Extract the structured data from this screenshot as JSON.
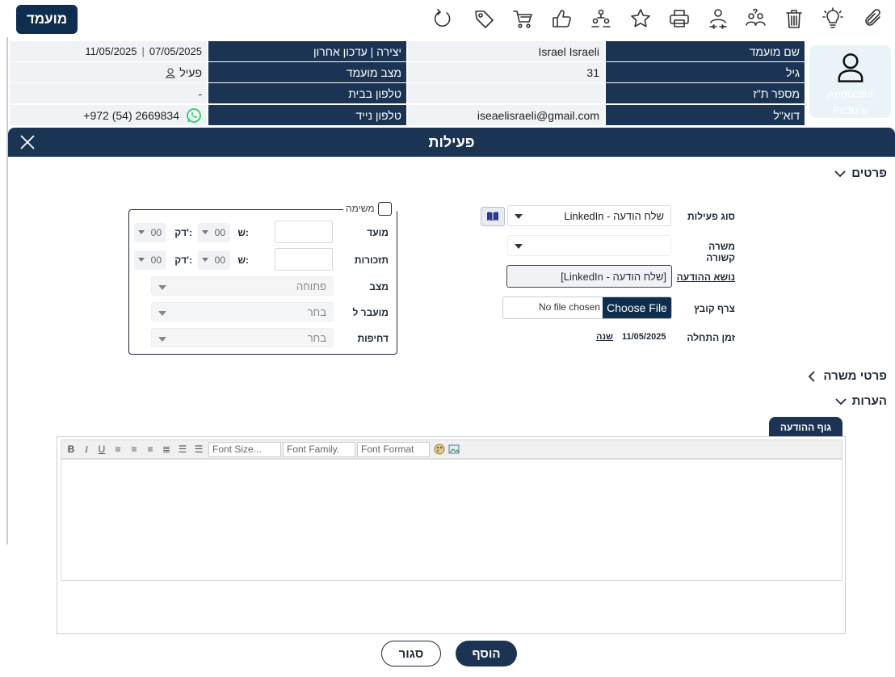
{
  "toolbar": {
    "candidate_button": "מועמד",
    "icons": [
      "attach-icon",
      "lightbulb-icon",
      "trash-icon",
      "users-question-icon",
      "transfer-user-icon",
      "print-icon",
      "star-icon",
      "org-chart-icon",
      "thumbs-up-icon",
      "cart-icon",
      "tag-icon",
      "refresh-icon"
    ]
  },
  "info": {
    "photo_label": "Applicant Picture",
    "rows": [
      {
        "l1": "שם מועמד",
        "v1": "Israel Israeli",
        "l2": "יצירה | עדכון אחרון",
        "v2_created": "07/05/2025",
        "v2_updated": "11/05/2025"
      },
      {
        "l1": "גיל",
        "v1": "31",
        "l2": "מצב מועמד",
        "v2": "פעיל"
      },
      {
        "l1": "מספר ת\"ז",
        "v1": "",
        "l2": "טלפון בבית",
        "v2": "-"
      },
      {
        "l1": "דוא\"ל",
        "v1": "iseaelisraeli@gmail.com",
        "l2": "טלפון נייד",
        "v2": "+972 (54) 2669834"
      }
    ]
  },
  "panel": {
    "title": "פעילות",
    "section_details": "פרטים",
    "section_job": "פרטי משרה",
    "section_notes": "הערות"
  },
  "form": {
    "activity_type_label": "סוג פעילות",
    "activity_type_value": "LinkedIn - שלח הודעה",
    "related_job_label": "משרה קשורה",
    "related_job_value": "",
    "subject_label": "נושא ההודעה",
    "subject_value": "[LinkedIn - שלח הודעה]",
    "attach_label": "צרף קובץ",
    "choose_file": "Choose File",
    "no_file": "No file chosen",
    "start_label": "זמן התחלה",
    "start_value": "11/05/2025",
    "change_link": "שנה"
  },
  "task": {
    "legend": "משימה",
    "due_label": "מועד",
    "reminder_label": "תזכורות",
    "hour_label": "ש:",
    "minute_label": "דק':",
    "due_hour": "00",
    "due_min": "00",
    "rem_hour": "00",
    "rem_min": "00",
    "status_label": "מצב",
    "status_value": "פתוחה",
    "assigned_label": "מועבר ל",
    "assigned_value": "בחר",
    "priority_label": "דחיפות",
    "priority_value": "בחר"
  },
  "editor": {
    "tab_label": "גוף ההודעה",
    "font_size": "Font Size...",
    "font_family": "Font Family.",
    "font_format": "Font Format"
  },
  "buttons": {
    "add": "הוסף",
    "close": "סגור"
  },
  "colors": {
    "navy": "#1b3453",
    "accent": "#0f2d4f",
    "whatsapp": "#25d366"
  }
}
